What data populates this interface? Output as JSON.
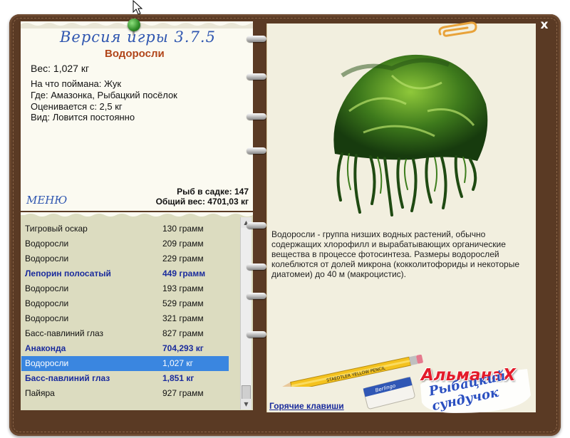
{
  "header": {
    "version": "Версия игры 3.7.5",
    "fish_name": "Водоросли"
  },
  "fish": {
    "weight": "Вес: 1,027 кг",
    "caught_on": "На что поймана: Жук",
    "location": "Где: Амазонка, Рыбацкий посёлок",
    "valued_from": "Оценивается с: 2,5 кг",
    "kind": "Вид: Ловится постоянно"
  },
  "menu_label": "МЕНЮ",
  "summary": {
    "in_cage": "Рыб в садке: 147",
    "total_weight": "Общий вес: 4701,03 кг"
  },
  "catch_list": [
    {
      "name": "Тигровый оскар",
      "weight": "130 грамм",
      "bold": false,
      "selected": false
    },
    {
      "name": "Водоросли",
      "weight": "209 грамм",
      "bold": false,
      "selected": false
    },
    {
      "name": "Водоросли",
      "weight": "229 грамм",
      "bold": false,
      "selected": false
    },
    {
      "name": "Лепорин полосатый",
      "weight": "449 грамм",
      "bold": true,
      "selected": false
    },
    {
      "name": "Водоросли",
      "weight": "193 грамм",
      "bold": false,
      "selected": false
    },
    {
      "name": "Водоросли",
      "weight": "529 грамм",
      "bold": false,
      "selected": false
    },
    {
      "name": "Водоросли",
      "weight": "321 грамм",
      "bold": false,
      "selected": false
    },
    {
      "name": "Басс-павлиний глаз",
      "weight": "827 грамм",
      "bold": false,
      "selected": false
    },
    {
      "name": "Анаконда",
      "weight": "704,293 кг",
      "bold": true,
      "selected": false
    },
    {
      "name": "Водоросли",
      "weight": "1,027 кг",
      "bold": false,
      "selected": true
    },
    {
      "name": "Басс-павлиний глаз",
      "weight": "1,851 кг",
      "bold": true,
      "selected": false
    },
    {
      "name": "Пайяра",
      "weight": "927 грамм",
      "bold": false,
      "selected": false
    }
  ],
  "description": "Водоросли - группа низших водных растений, обычно содержащих хлорофилл и вырабатывающих органические вещества в процессе фотосинтеза. Размеры водорослей колеблются от долей микрона (кокколитофориды и некоторые диатомеи) до 40 м (макроцистис).",
  "hotkeys_label": "Горячие клавиши",
  "close_label": "x",
  "logo": {
    "title": "АльманаХ",
    "subtitle": "Рыбацкий сундучок"
  },
  "pencil_text": "STAEDTLER YELLOW PENCIL",
  "eraser_text": "Berlingo",
  "colors": {
    "album": "#5a3a24",
    "paper": "#fbfaf1",
    "list_paper": "#dcdcc0",
    "selection": "#3a86e0",
    "link": "#2f56b0",
    "title": "#b1451a",
    "bold_rows": "#1a2b9c"
  }
}
